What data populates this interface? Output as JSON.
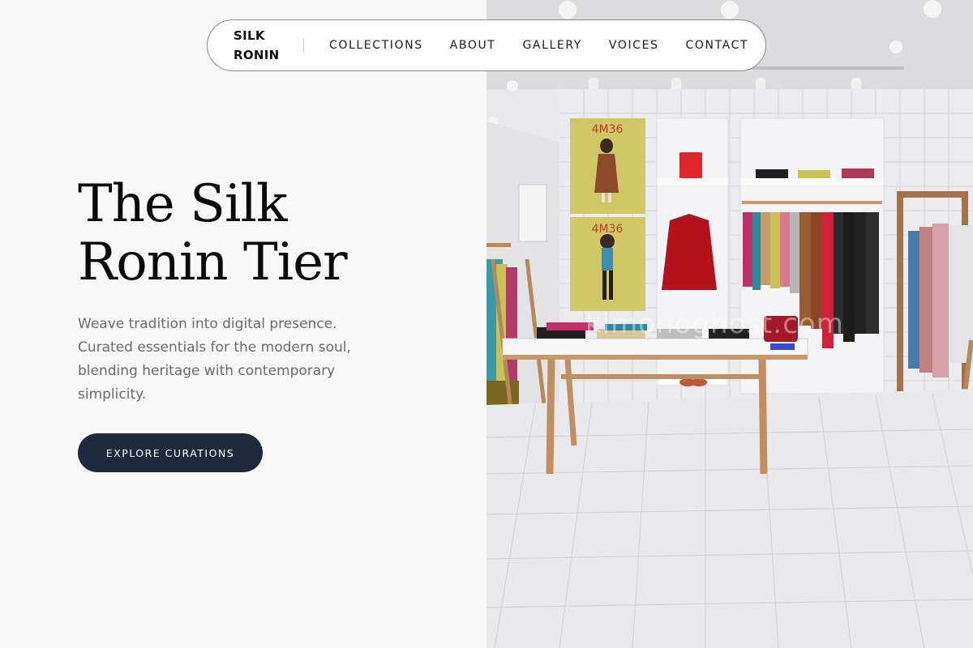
{
  "brand": {
    "line1": "SILK",
    "line2": "RONIN"
  },
  "nav": {
    "items": [
      {
        "label": "COLLECTIONS"
      },
      {
        "label": "ABOUT"
      },
      {
        "label": "GALLERY"
      },
      {
        "label": "VOICES"
      },
      {
        "label": "CONTACT"
      }
    ]
  },
  "hero": {
    "headline_line1": "The Silk",
    "headline_line2": "Ronin Tier",
    "tagline": "Weave tradition into digital presence. Curated essentials for the modern soul, blending heritage with contemporary simplicity.",
    "cta_label": "EXPLORE CURATIONS"
  },
  "image": {
    "poster_text_top": "4M36",
    "poster_text_bottom": "4M36",
    "watermark": "kimonoghost.com"
  },
  "colors": {
    "cta_background": "#1e293b",
    "headline": "#0a0a0a",
    "tagline": "#6b6b6b",
    "poster": "#cfc865",
    "jacket": "#b3121c"
  }
}
